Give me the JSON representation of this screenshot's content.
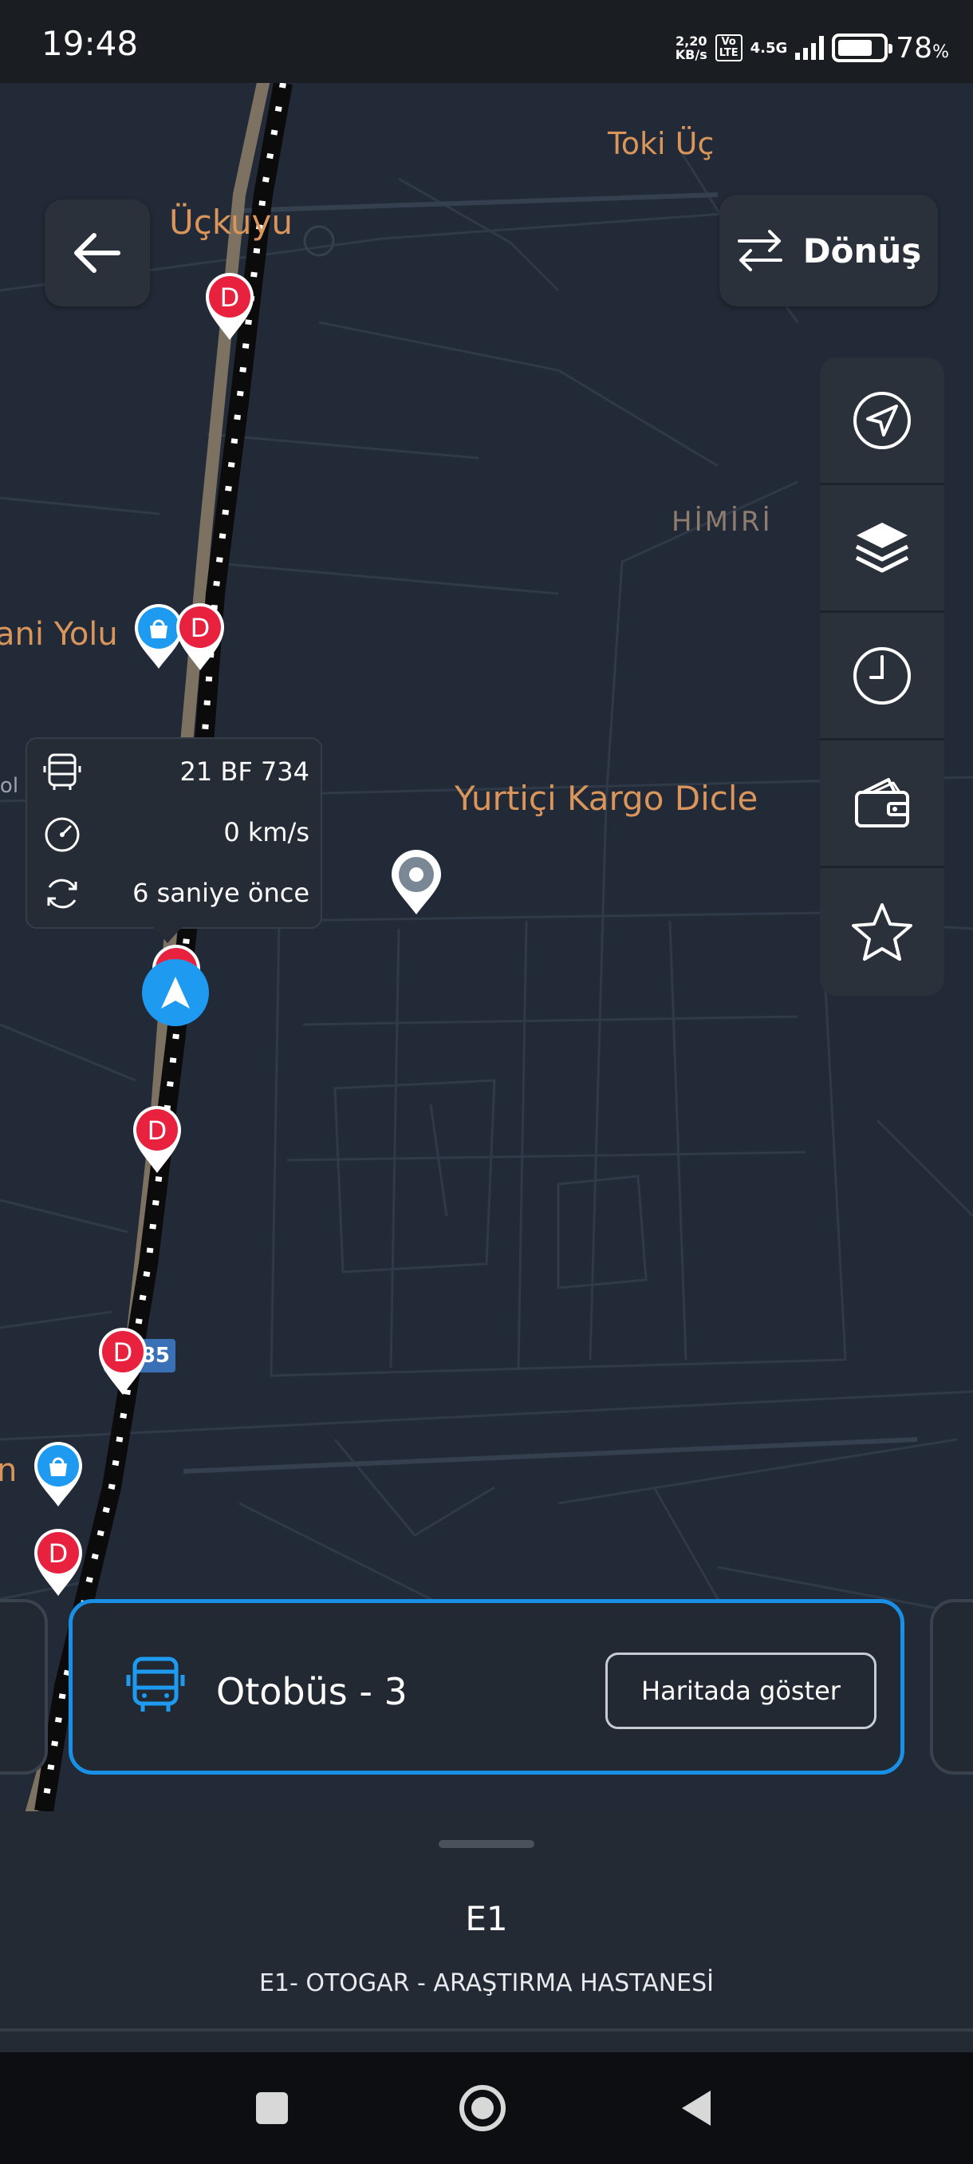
{
  "status_bar": {
    "time": "19:48",
    "net_speed_value": "2,20",
    "net_speed_unit": "KB/s",
    "volte_top": "Vo",
    "volte_bottom": "LTE",
    "network": "4.5G",
    "battery_percent": "78",
    "battery_unit": "%",
    "battery_level": 0.78
  },
  "map": {
    "labels": {
      "uckuyu": "Üçkuyu",
      "toki": "Toki Üç",
      "himiri": "HİMİRİ",
      "yolu": "ani Yolu",
      "edge_n": "n",
      "edge_ool": "ool"
    },
    "place": {
      "name": "Yurtiçi Kargo Dicle"
    },
    "road_shield": "D885",
    "stop_letter": "D",
    "colors": {
      "stop": "#e8213f",
      "mall": "#1e9bf0",
      "label": "#d9955a",
      "accent": "#1a8fe6"
    }
  },
  "toolbar": {
    "back_icon": "arrow-left-icon",
    "donus_label": "Dönüş",
    "donus_icon": "swap-arrows-icon",
    "side_items": [
      "navigation-arrow-icon",
      "layers-icon",
      "clock-icon",
      "wallet-icon",
      "star-icon"
    ]
  },
  "vehicle_popup": {
    "plate": "21 BF 734",
    "speed": "0 km/s",
    "updated": "6 saniye önce"
  },
  "vehicle_card": {
    "title": "Otobüs - 3",
    "button": "Haritada göster"
  },
  "bottom_sheet": {
    "route_code": "E1",
    "route_name": "E1- OTOGAR - ARAŞTIRMA HASTANESİ"
  }
}
